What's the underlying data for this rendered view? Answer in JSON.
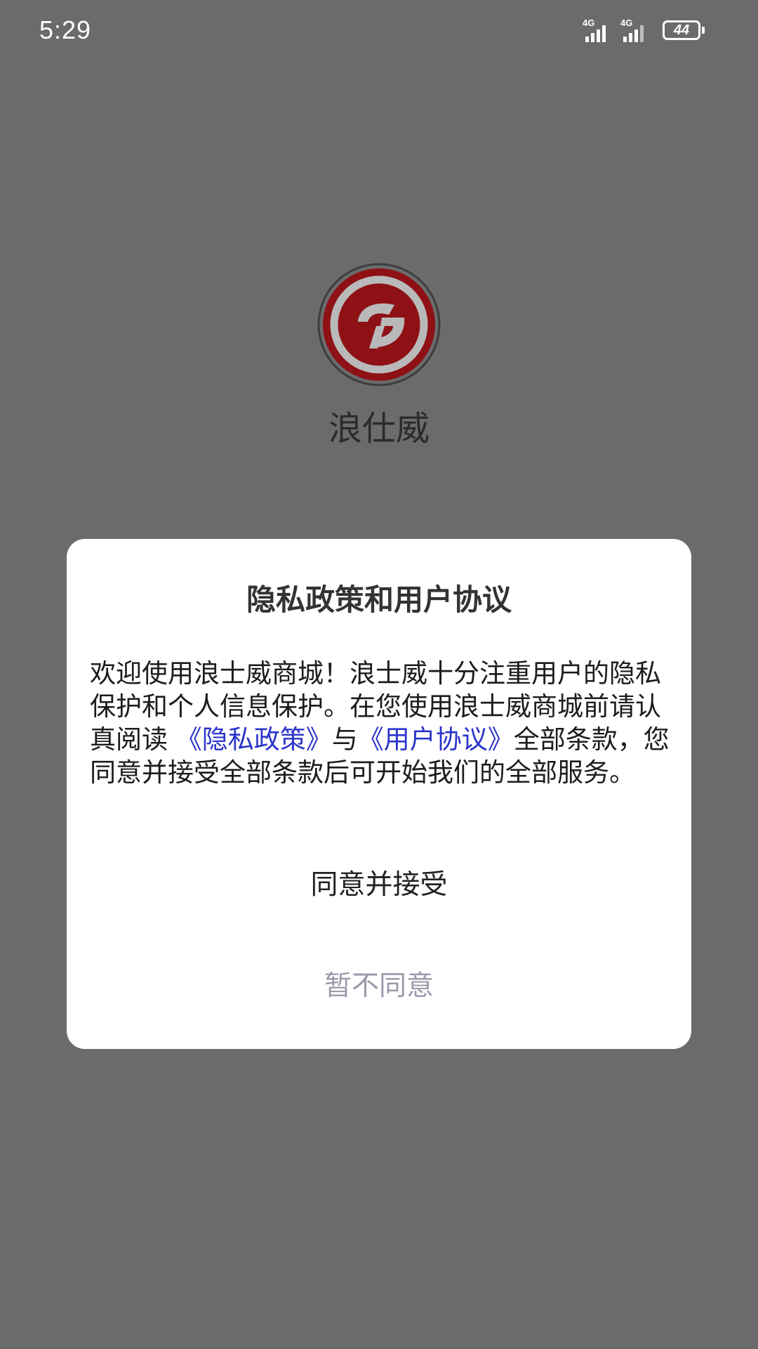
{
  "status_bar": {
    "time": "5:29",
    "network_1": "4G",
    "network_2": "4G",
    "battery": "44"
  },
  "app": {
    "name": "浪仕威",
    "logo_icon": "brand-logo-icon",
    "brand_color": "#8e1116"
  },
  "dialog": {
    "title": "隐私政策和用户协议",
    "body_part1": "欢迎使用浪士威商城！浪士威十分注重用户的隐私保护和个人信息保护。在您使用浪士威商城前请认真阅读 ",
    "privacy_link": "《隐私政策》",
    "body_part2": "与",
    "agreement_link": "《用户协议》",
    "body_part3": "全部条款，您同意并接受全部条款后可开始我们的全部服务。",
    "agree_label": "同意并接受",
    "decline_label": "暂不同意",
    "link_color": "#2b35c9"
  }
}
